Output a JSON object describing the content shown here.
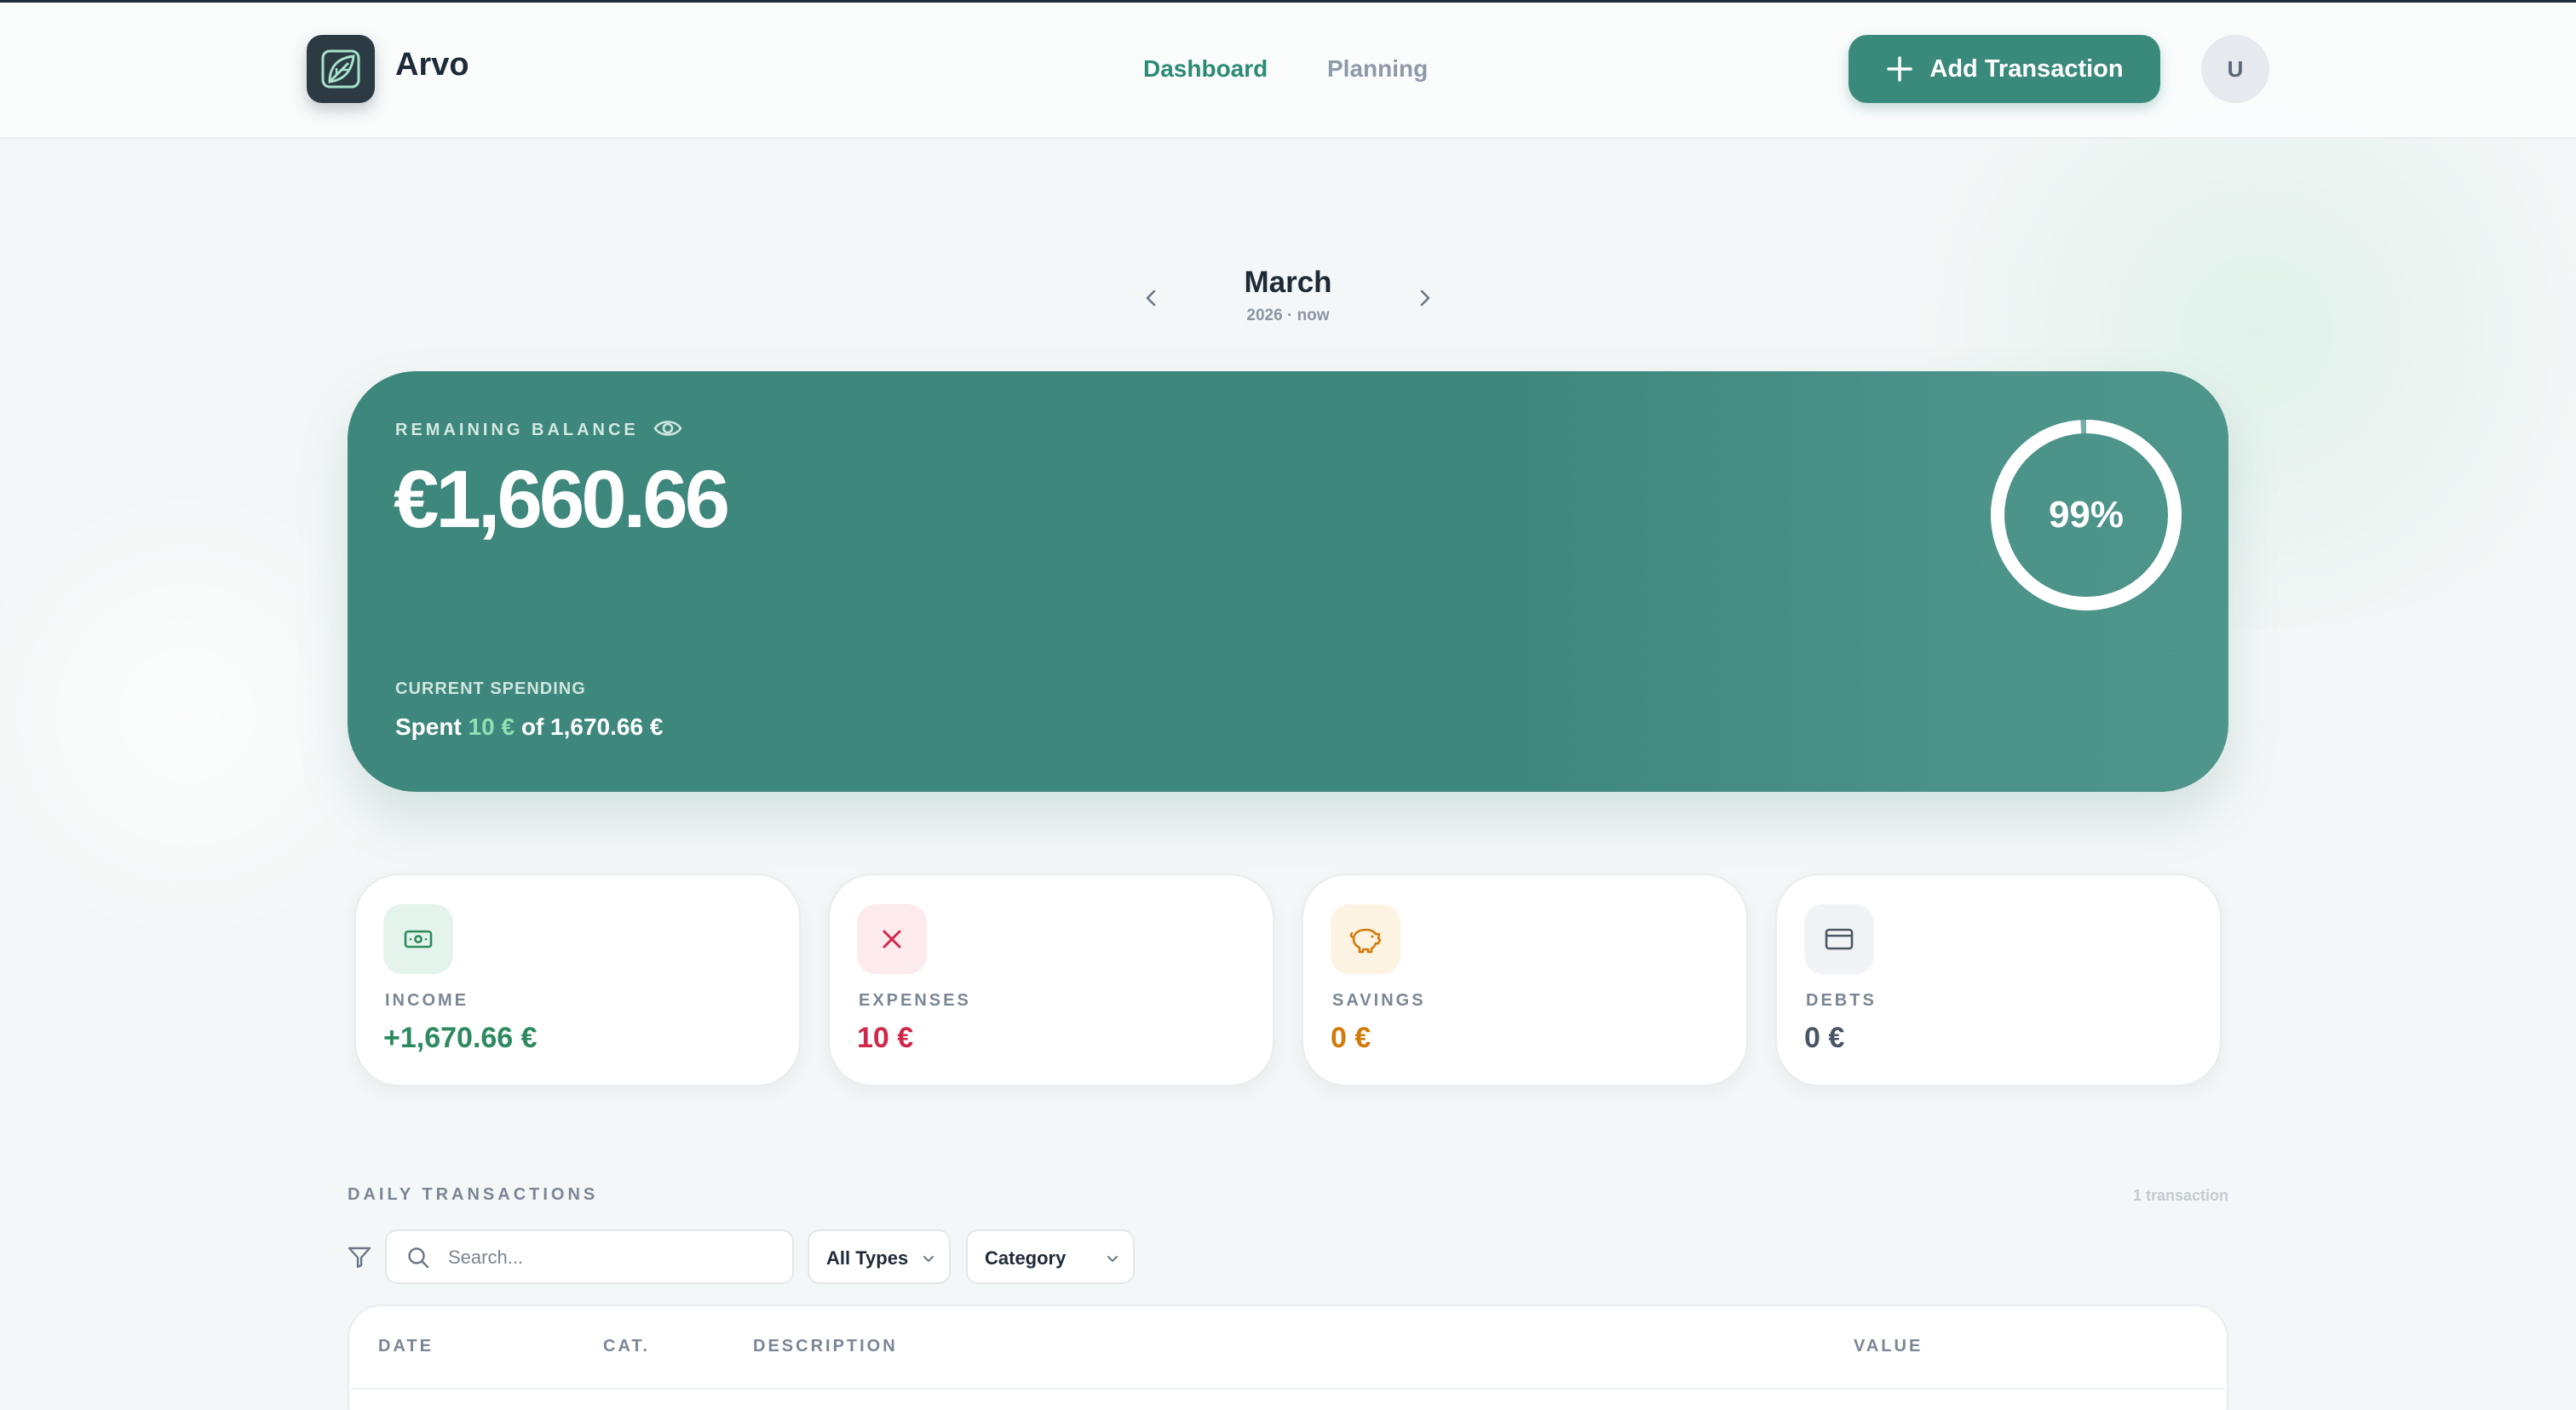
{
  "app": {
    "name": "Arvo"
  },
  "nav": {
    "dashboard": "Dashboard",
    "planning": "Planning"
  },
  "header": {
    "add_transaction": "Add Transaction",
    "avatar_initial": "U"
  },
  "month": {
    "title": "March",
    "subtitle": "2026 · now"
  },
  "balance": {
    "label": "REMAINING BALANCE",
    "amount": "€1,660.66",
    "percent_label": "99%",
    "percent_remaining": 0.99,
    "spending_label": "CURRENT SPENDING",
    "spent_prefix": "Spent",
    "spent_value": "10 €",
    "spent_suffix": "of 1,670.66 €"
  },
  "stats": {
    "income": {
      "label": "INCOME",
      "value": "+1,670.66 €"
    },
    "expenses": {
      "label": "EXPENSES",
      "value": "10 €"
    },
    "savings": {
      "label": "SAVINGS",
      "value": "0 €"
    },
    "debts": {
      "label": "DEBTS",
      "value": "0 €"
    }
  },
  "transactions": {
    "heading": "DAILY TRANSACTIONS",
    "count": "1 transaction",
    "search_placeholder": "Search...",
    "type_filter": "All Types",
    "category_filter": "Category",
    "columns": {
      "date": "DATE",
      "category": "CAT.",
      "description": "DESCRIPTION",
      "value": "VALUE"
    }
  },
  "colors": {
    "accent": "#3a8a7c",
    "income": "#2d8a5e",
    "expenses": "#d0284b",
    "savings": "#d27a0b",
    "debts": "#4b5563"
  }
}
